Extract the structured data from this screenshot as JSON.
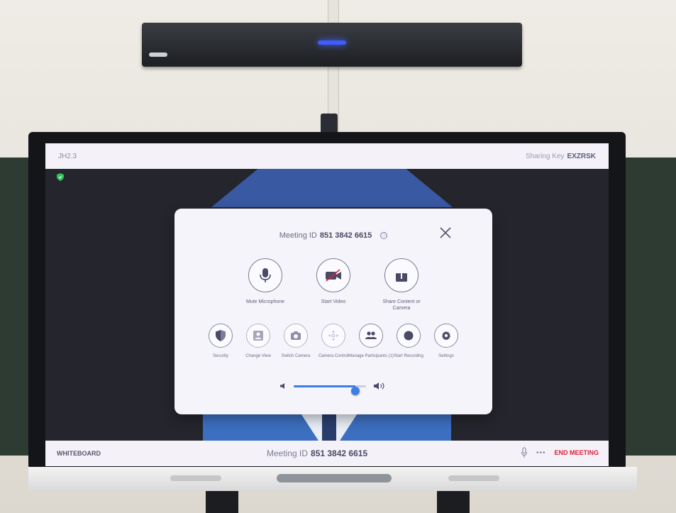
{
  "top_bar": {
    "room_name": "JH2.3",
    "sharing_label": "Sharing Key",
    "sharing_key": "EXZRSK"
  },
  "modal": {
    "meeting_id_label": "Meeting ID",
    "meeting_id": "851 3842 6615",
    "info_glyph": "ⓘ",
    "primary_actions": [
      {
        "label": "Mute Microphone",
        "icon": "microphone-icon"
      },
      {
        "label": "Start Video",
        "icon": "video-off-icon"
      },
      {
        "label": "Share Content or Camera",
        "icon": "share-icon"
      }
    ],
    "secondary_actions": [
      {
        "label": "Security",
        "icon": "shield-icon"
      },
      {
        "label": "Change View",
        "icon": "change-view-icon"
      },
      {
        "label": "Switch Camera",
        "icon": "camera-icon"
      },
      {
        "label": "Camera Control",
        "icon": "camera-control-icon"
      },
      {
        "label": "Manage Participants (1)",
        "icon": "participants-icon"
      },
      {
        "label": "Start Recording",
        "icon": "record-icon"
      },
      {
        "label": "Settings",
        "icon": "gear-icon"
      }
    ],
    "volume_level": 0.85
  },
  "bottom_bar": {
    "whiteboard_label": "WHITEBOARD",
    "meeting_id_label": "Meeting ID",
    "meeting_id": "851 3842 6615",
    "more_glyph": "•••",
    "end_meeting_label": "END MEETING"
  },
  "colors": {
    "accent": "#3c7ee6",
    "end_meeting": "#e0203a",
    "secure": "#2fbf5a"
  }
}
